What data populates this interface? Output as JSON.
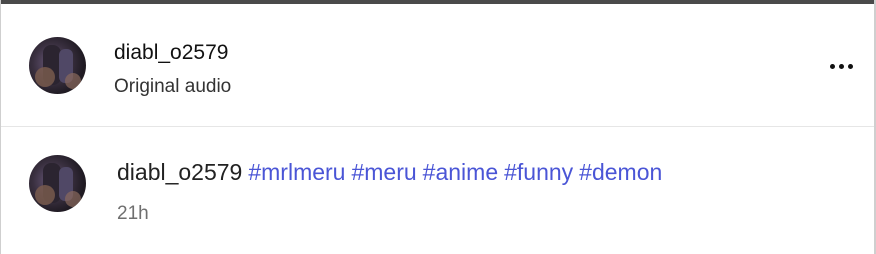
{
  "post_header": {
    "username": "diabl_o2579",
    "audio_label": "Original audio",
    "more_icon": "more-horizontal-icon"
  },
  "caption": {
    "username": "diabl_o2579",
    "hashtags": [
      "#mrlmeru",
      "#meru",
      "#anime",
      "#funny",
      "#demon"
    ],
    "time": "21h"
  },
  "colors": {
    "hashtag": "#4a55d6",
    "text": "#111111",
    "muted": "#6f6f6f"
  }
}
